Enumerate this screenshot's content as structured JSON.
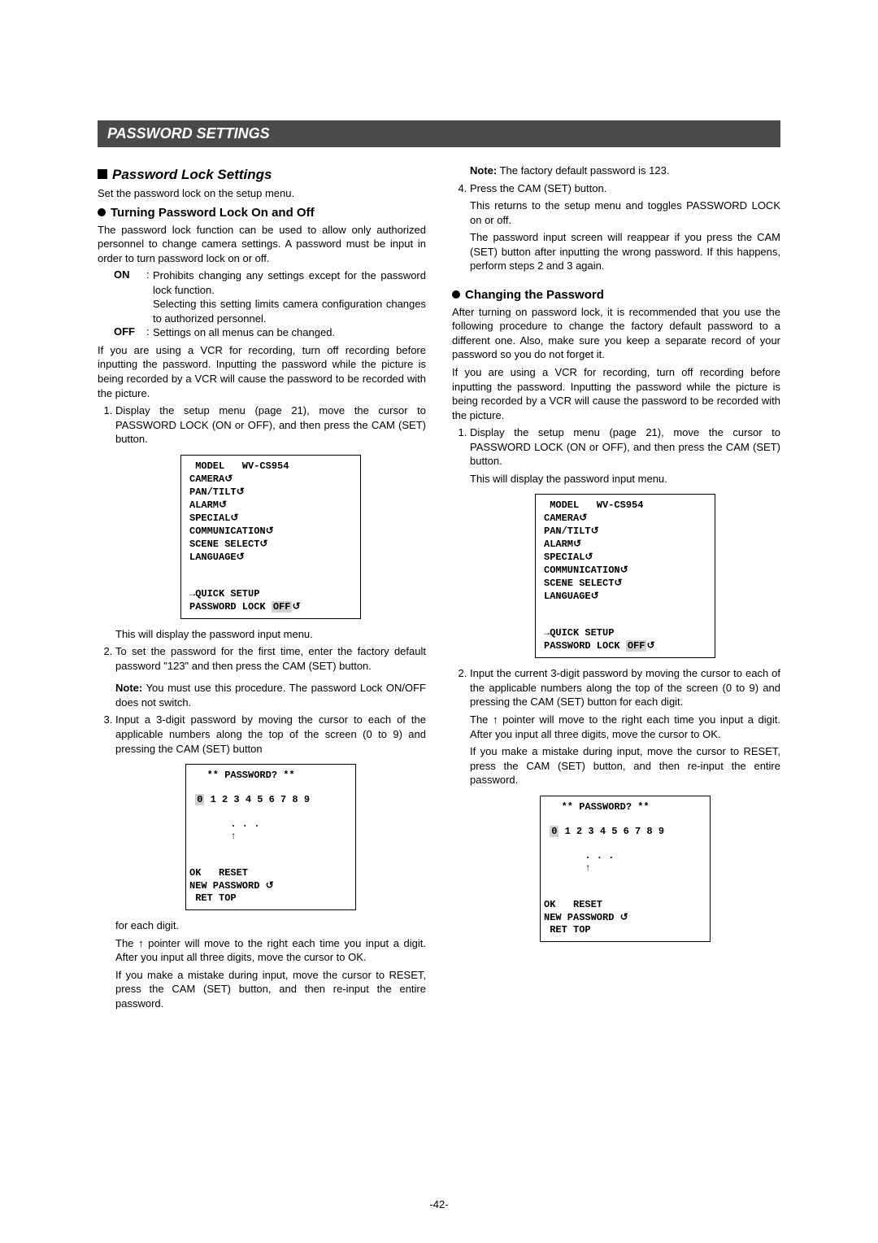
{
  "titlebar": "PASSWORD SETTINGS",
  "h2_lock": "Password Lock Settings",
  "p_set": "Set the password lock on the setup menu.",
  "h3_turn": "Turning Password Lock On and Off",
  "p_turn1": "The password lock function can be used to allow only authorized personnel to change camera settings. A password must be input in order to turn password lock on or off.",
  "on_key": "ON",
  "on_val1": "Prohibits changing any settings except for the password lock function.",
  "on_val2": "Selecting this setting limits camera configuration changes to authorized personnel.",
  "off_key": "OFF",
  "off_val": "Settings on all menus can be changed.",
  "p_vcr": "If you are using a VCR for recording, turn off recording before inputting the password. Inputting the password while the picture is being recorded by a VCR will cause the password to be recorded with the picture.",
  "li1": "Display the setup menu (page 21), move the cursor to PASSWORD LOCK (ON or OFF), and then press the CAM (SET) button.",
  "li1_after": "This will display the password input menu.",
  "li2": "To set the password for the first time, enter the factory default password \"123\" and then press the CAM (SET) button.",
  "note1_label": "Note:",
  "note1_text": " You must use this procedure. The password Lock ON/OFF does not switch.",
  "li3": "Input a 3-digit password by moving the cursor to each of the applicable numbers along the top of the screen (0 to 9) and pressing the CAM (SET) button",
  "p_each": "for each digit.",
  "p_ptr": "The ↑ pointer will move to the right each time you input a digit. After you input all three digits, move the cursor to OK.",
  "p_mistake": "If you make a mistake during input, move the cursor to RESET, press the CAM (SET) button, and then re-input the entire password.",
  "note2_label": "Note:",
  "note2_text": " The factory default password is 123.",
  "li4": "Press the CAM (SET) button.",
  "li4_a": "This returns to the setup menu and toggles PASSWORD LOCK on or off.",
  "li4_b": "The password input screen will reappear if you press the CAM (SET) button after inputting the wrong password. If this happens, perform steps 2 and 3 again.",
  "h3_change": "Changing the Password",
  "p_change1": "After turning on password lock, it is recommended that you use the following procedure to change the factory default password to a different one. Also, make sure you keep a separate record of your password so you do not forget it.",
  "p_change_vcr": "If you are using a VCR for recording, turn off recording before inputting the password. Inputting the password while the picture is being recorded by a VCR will cause the password to be recorded with the picture.",
  "rli1": "Display the setup menu (page 21), move the cursor to PASSWORD LOCK (ON or OFF), and then press the CAM (SET) button.",
  "rli1_after": "This will display the password input menu.",
  "rli2": "Input the current 3-digit password by moving the cursor to each of the applicable numbers along the top of the screen (0 to 9) and pressing the CAM (SET) button for each digit.",
  "rli2_a": "The ↑ pointer will move to the right each time you input a digit. After you input all three digits, move the cursor to OK.",
  "rli2_b": "If you make a mistake during input, move the cursor to RESET, press the CAM (SET) button, and then re-input the entire password.",
  "osd1": {
    "l1": " MODEL   WV-CS954",
    "l2": "CAMERA",
    "l3": "PAN/TILT",
    "l4": "ALARM",
    "l5": "SPECIAL",
    "l6": "COMMUNICATION",
    "l7": "SCENE SELECT",
    "l8": "LANGUAGE",
    "blank": "",
    "l9a": "→QUICK SETUP",
    "l10a": "PASSWORD LOCK ",
    "l10b": "OFF"
  },
  "osd2": {
    "title": "   ** PASSWORD? **",
    "nums_pre": " ",
    "n0": "0",
    "nums_post": " 1 2 3 4 5 6 7 8 9",
    "dots": "       . . .",
    "arrow": "       ↑",
    "ok": "OK   RESET",
    "new": "NEW PASSWORD ",
    "ret": " RET TOP"
  },
  "footer": "-42-"
}
